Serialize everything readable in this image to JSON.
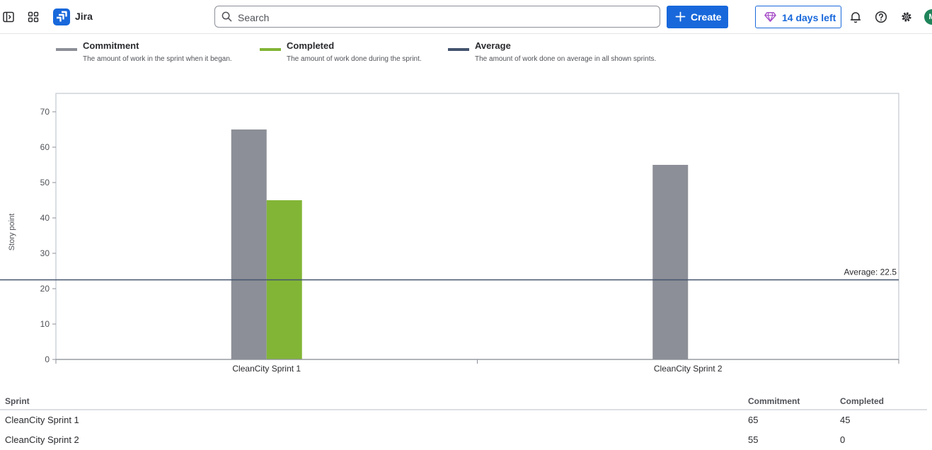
{
  "topbar": {
    "app_name": "Jira",
    "search_placeholder": "Search",
    "create_label": "Create",
    "trial_label": "14 days left",
    "avatar_initial": "M",
    "brand_color": "#1868db",
    "icons": [
      "sidebar-toggle-icon",
      "app-switcher-icon",
      "jira-logo-icon",
      "search-icon",
      "plus-icon",
      "gem-icon",
      "bell-icon",
      "help-icon",
      "gear-icon"
    ]
  },
  "legend": [
    {
      "title": "Commitment",
      "desc": "The amount of work in the sprint when it began.",
      "color": "#8c8f97"
    },
    {
      "title": "Completed",
      "desc": "The amount of work done during the sprint.",
      "color": "#82b536"
    },
    {
      "title": "Average",
      "desc": "The amount of work done on average in all shown sprints.",
      "color": "#44546f"
    }
  ],
  "chart_data": {
    "type": "bar",
    "ylabel": "Story point",
    "ylim": [
      0,
      70
    ],
    "yticks": [
      0,
      10,
      20,
      30,
      40,
      50,
      60,
      70
    ],
    "categories": [
      "CleanCity Sprint 1",
      "CleanCity Sprint 2"
    ],
    "series": [
      {
        "name": "Commitment",
        "values": [
          65,
          55
        ],
        "color": "#8c8f97"
      },
      {
        "name": "Completed",
        "values": [
          45,
          0
        ],
        "color": "#82b536"
      }
    ],
    "average": {
      "value": 22.5,
      "label": "Average: 22.5",
      "color": "#44546f"
    },
    "grid": false
  },
  "table": {
    "headers": [
      "Sprint",
      "Commitment",
      "Completed"
    ],
    "rows": [
      [
        "CleanCity Sprint 1",
        "65",
        "45"
      ],
      [
        "CleanCity Sprint 2",
        "55",
        "0"
      ]
    ]
  }
}
